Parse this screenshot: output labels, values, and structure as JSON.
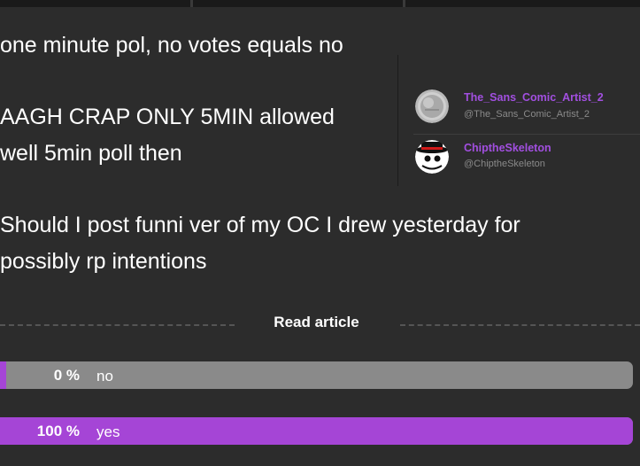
{
  "post": {
    "line1": "one minute pol, no votes equals no",
    "line2": "AAGH CRAP ONLY 5MIN allowed",
    "line3": "well 5min poll then",
    "line4": "Should I post funni ver of my OC I drew yesterday for",
    "line5": "possibly rp intentions"
  },
  "users": [
    {
      "name": "The_Sans_Comic_Artist_2",
      "handle": "@The_Sans_Comic_Artist_2",
      "avatar_icon": "silver-coin-avatar-icon"
    },
    {
      "name": "ChiptheSkeleton",
      "handle": "@ChiptheSkeleton",
      "avatar_icon": "skeleton-fedora-avatar-icon"
    }
  ],
  "read_article": {
    "label": "Read article"
  },
  "poll": {
    "options": [
      {
        "percent_label": "0 %",
        "label": "no",
        "fraction": 0.0
      },
      {
        "percent_label": "100 %",
        "label": "yes",
        "fraction": 1.0
      }
    ]
  },
  "colors": {
    "background": "#2c2c2c",
    "accent_purple": "#a545d6",
    "username_purple": "#a24fe0",
    "bar_gray": "#8a8a8a"
  }
}
